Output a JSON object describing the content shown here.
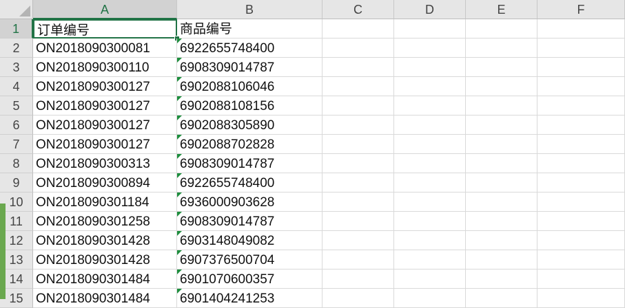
{
  "sheet": {
    "columns": [
      "A",
      "B",
      "C",
      "D",
      "E",
      "F"
    ],
    "active_column": "A",
    "active_row": "1",
    "rows": [
      {
        "num": "1",
        "a": "订单编号",
        "b": "商品编号",
        "b_flag": false
      },
      {
        "num": "2",
        "a": "ON2018090300081",
        "b": "6922655748400",
        "b_flag": true
      },
      {
        "num": "3",
        "a": "ON2018090300110",
        "b": "6908309014787",
        "b_flag": true
      },
      {
        "num": "4",
        "a": "ON2018090300127",
        "b": "6902088106046",
        "b_flag": true
      },
      {
        "num": "5",
        "a": "ON2018090300127",
        "b": "6902088108156",
        "b_flag": true
      },
      {
        "num": "6",
        "a": "ON2018090300127",
        "b": "6902088305890",
        "b_flag": true
      },
      {
        "num": "7",
        "a": "ON2018090300127",
        "b": "6902088702828",
        "b_flag": true
      },
      {
        "num": "8",
        "a": "ON2018090300313",
        "b": "6908309014787",
        "b_flag": true
      },
      {
        "num": "9",
        "a": "ON2018090300894",
        "b": "6922655748400",
        "b_flag": true
      },
      {
        "num": "10",
        "a": "ON2018090301184",
        "b": "6936000903628",
        "b_flag": true
      },
      {
        "num": "11",
        "a": "ON2018090301258",
        "b": "6908309014787",
        "b_flag": true
      },
      {
        "num": "12",
        "a": "ON2018090301428",
        "b": "6903148049082",
        "b_flag": true
      },
      {
        "num": "13",
        "a": "ON2018090301428",
        "b": "6907376500704",
        "b_flag": true
      },
      {
        "num": "14",
        "a": "ON2018090301484",
        "b": "6901070600357",
        "b_flag": true
      },
      {
        "num": "15",
        "a": "ON2018090301484",
        "b": "6901404241253",
        "b_flag": true
      }
    ]
  },
  "colors": {
    "accent": "#217346",
    "error_flag": "#1e8e3e"
  },
  "icons": {
    "corner": "select-all-triangle-icon",
    "flag": "number-as-text-flag-icon"
  }
}
